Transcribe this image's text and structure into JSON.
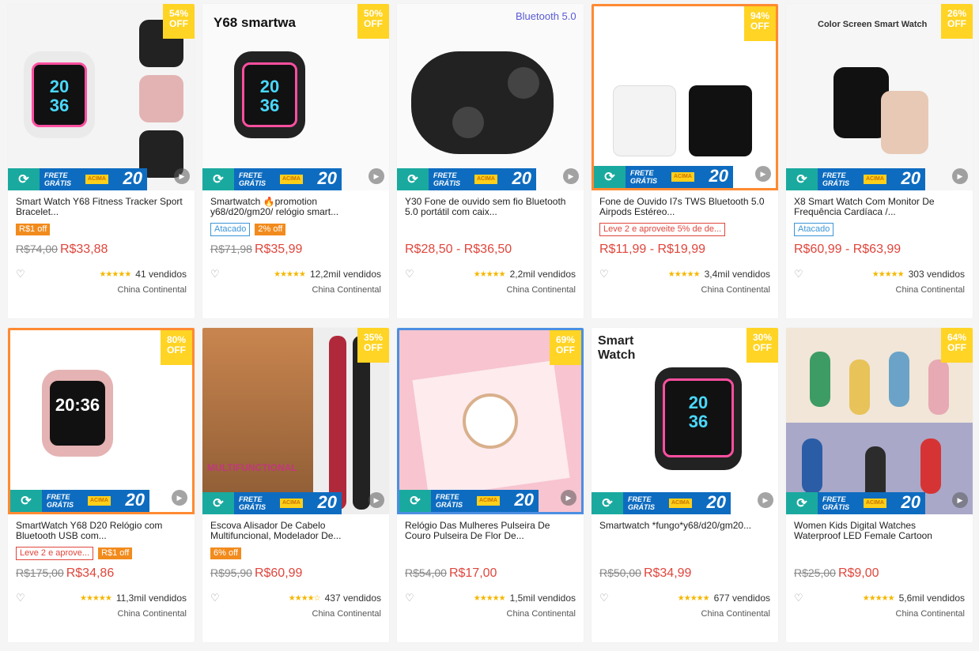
{
  "products": [
    {
      "title": "Smart Watch Y68 Fitness Tracker Sport Bracelet...",
      "discount": [
        "54%",
        "OFF"
      ],
      "tags": [
        {
          "text": "R$1 off",
          "style": "orange"
        }
      ],
      "price_old": "R$74,00",
      "price": "R$33,88",
      "stars": "★★★★★",
      "sold": "41 vendidos",
      "origin": "China Continental",
      "img": "white",
      "border": ""
    },
    {
      "title": "Smartwatch 🔥promotion y68/d20/gm20/ relógio smart...",
      "discount": [
        "50%",
        "OFF"
      ],
      "tags": [
        {
          "text": "Atacado",
          "style": "blue"
        },
        {
          "text": "2% off",
          "style": "orange"
        }
      ],
      "price_old": "R$71,98",
      "price": "R$35,99",
      "stars": "★★★★★",
      "sold": "12,2mil vendidos",
      "origin": "China Continental",
      "img": "black",
      "border": ""
    },
    {
      "title": "Y30 Fone de ouvido sem fio Bluetooth 5.0 portátil com caix...",
      "discount": null,
      "tags": [],
      "price_old": "",
      "price": "R$28,50 - R$36,50",
      "stars": "★★★★★",
      "sold": "2,2mil vendidos",
      "origin": "China Continental",
      "img": "earbuds",
      "border": ""
    },
    {
      "title": "Fone de Ouvido I7s TWS Bluetooth 5.0 Airpods Estéreo...",
      "discount": [
        "94%",
        "OFF"
      ],
      "tags": [
        {
          "text": "Leve 2 e aproveite 5% de de...",
          "style": "red"
        }
      ],
      "price_old": "",
      "price": "R$11,99 - R$19,99",
      "stars": "★★★★★",
      "sold": "3,4mil vendidos",
      "origin": "China Continental",
      "img": "airpods",
      "border": "bordered"
    },
    {
      "title": "X8 Smart Watch Com Monitor De Frequência Cardíaca /...",
      "discount": [
        "26%",
        "OFF"
      ],
      "tags": [
        {
          "text": "Atacado",
          "style": "blue"
        }
      ],
      "price_old": "",
      "price": "R$60,99 - R$63,99",
      "stars": "★★★★★",
      "sold": "303 vendidos",
      "origin": "China Continental",
      "img": "x8",
      "border": ""
    },
    {
      "title": "SmartWatch Y68 D20 Relógio com Bluetooth USB com...",
      "discount": [
        "80%",
        "OFF"
      ],
      "tags": [
        {
          "text": "Leve 2 e aprove...",
          "style": "red"
        },
        {
          "text": "R$1 off",
          "style": "orange"
        }
      ],
      "price_old": "R$175,00",
      "price": "R$34,86",
      "stars": "★★★★★",
      "sold": "11,3mil vendidos",
      "origin": "China Continental",
      "img": "pink",
      "border": "bordered"
    },
    {
      "title": "Escova Alisador De Cabelo Multifuncional, Modelador De...",
      "discount": [
        "35%",
        "OFF"
      ],
      "tags": [
        {
          "text": "6% off",
          "style": "orange"
        }
      ],
      "price_old": "R$95,90",
      "price": "R$60,99",
      "stars": "★★★★☆",
      "sold": "437 vendidos",
      "origin": "China Continental",
      "img": "hair",
      "border": ""
    },
    {
      "title": "Relógio Das Mulheres Pulseira De Couro Pulseira De Flor De...",
      "discount": [
        "69%",
        "OFF"
      ],
      "tags": [],
      "price_old": "R$54,00",
      "price": "R$17,00",
      "stars": "★★★★★",
      "sold": "1,5mil vendidos",
      "origin": "China Continental",
      "img": "ladywatch",
      "border": "bordered-blue"
    },
    {
      "title": "Smartwatch *fungo*y68/d20/gm20...",
      "discount": [
        "30%",
        "OFF"
      ],
      "tags": [],
      "price_old": "R$50,00",
      "price": "R$34,99",
      "stars": "★★★★★",
      "sold": "677 vendidos",
      "origin": "China Continental",
      "img": "black2",
      "border": ""
    },
    {
      "title": "Women Kids Digital Watches Waterproof LED Female Cartoon",
      "discount": [
        "64%",
        "OFF"
      ],
      "tags": [],
      "price_old": "R$25,00",
      "price": "R$9,00",
      "stars": "★★★★★",
      "sold": "5,6mil vendidos",
      "origin": "China Continental",
      "img": "kids",
      "border": ""
    }
  ],
  "banner": {
    "frete1": "FRETE",
    "frete2": "GRÁTIS",
    "yellow": "ACIMA",
    "amount": "20"
  },
  "heart_icon": "heart-icon",
  "play_icon": "play-icon"
}
